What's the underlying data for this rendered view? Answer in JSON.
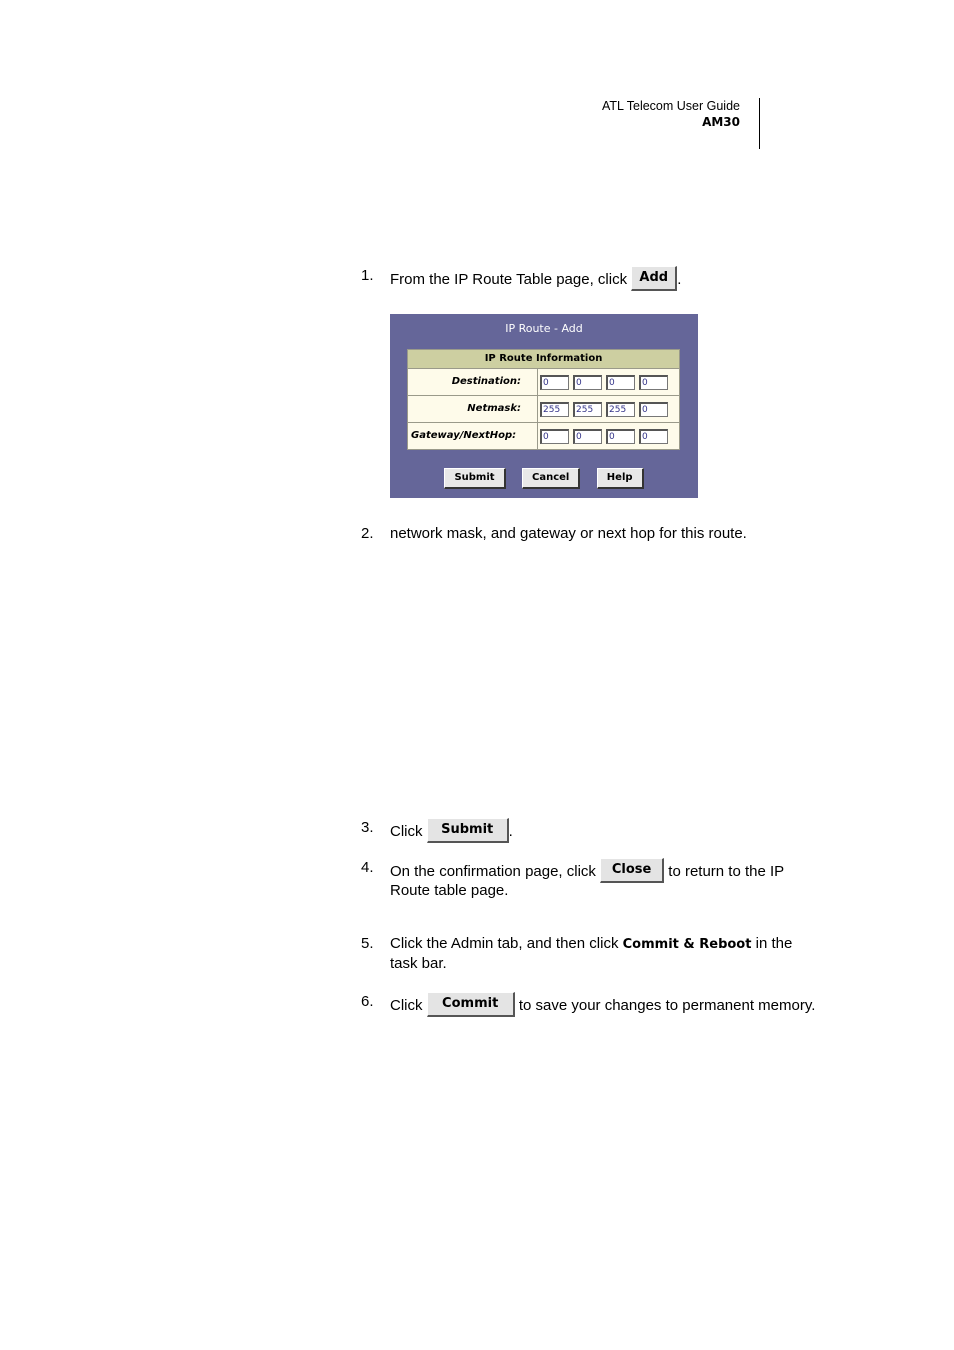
{
  "header": {
    "guide_title": "ATL Telecom User Guide",
    "model": "AM30"
  },
  "steps": [
    {
      "num": "1.",
      "before": "From the IP Route Table page, click ",
      "button": "Add",
      "after": "."
    },
    {
      "num": "2.",
      "text": "network mask, and gateway or next hop for this route."
    },
    {
      "num": "3.",
      "before": "Click ",
      "button": "Submit",
      "after": "."
    },
    {
      "num": "4.",
      "before": "On the confirmation page, click ",
      "button": "Close",
      "after": " to return to the IP Route table page."
    },
    {
      "num": "5.",
      "before": "Click the Admin tab, and then click ",
      "bold": "Commit & Reboot",
      "after": " in the task bar."
    },
    {
      "num": "6.",
      "before": "Click ",
      "button": "Commit",
      "after": " to save your changes to permanent memory."
    }
  ],
  "dialog": {
    "title": "IP Route - Add",
    "section_header": "IP Route Information",
    "fields": [
      {
        "label": "Destination:",
        "values": [
          "0",
          "0",
          "0",
          "0"
        ]
      },
      {
        "label": "Netmask:",
        "values": [
          "255",
          "255",
          "255",
          "0"
        ]
      },
      {
        "label": "Gateway/NextHop:",
        "values": [
          "0",
          "0",
          "0",
          "0"
        ]
      }
    ],
    "buttons": {
      "submit": "Submit",
      "cancel": "Cancel",
      "help": "Help"
    }
  },
  "colors": {
    "dialog_bg": "#656699",
    "table_header_bg": "#cdcfa1",
    "table_row_bg": "#fefbea"
  }
}
